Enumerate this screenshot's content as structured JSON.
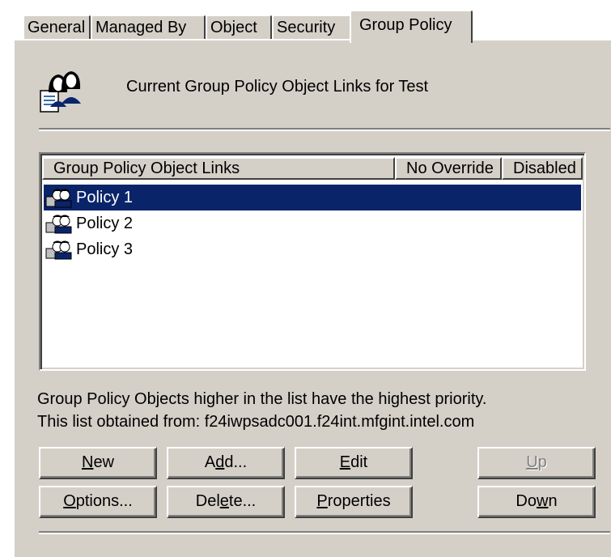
{
  "tabs": [
    {
      "label": "General"
    },
    {
      "label": "Managed By"
    },
    {
      "label": "Object"
    },
    {
      "label": "Security"
    },
    {
      "label": "Group Policy"
    }
  ],
  "active_tab": "Group Policy",
  "header": {
    "icon": "group-users-icon",
    "text": "Current Group Policy Object Links for Test"
  },
  "list": {
    "columns": [
      {
        "label": "Group Policy Object Links"
      },
      {
        "label": "No Override"
      },
      {
        "label": "Disabled"
      }
    ],
    "rows": [
      {
        "name": "Policy 1",
        "icon": "gpo-icon",
        "selected": true
      },
      {
        "name": "Policy 2",
        "icon": "gpo-icon",
        "selected": false
      },
      {
        "name": "Policy 3",
        "icon": "gpo-icon",
        "selected": false
      }
    ]
  },
  "info": {
    "line1": "Group Policy Objects higher in the list have the highest priority.",
    "line2": "This list obtained from: f24iwpsadc001.f24int.mfgint.intel.com"
  },
  "buttons": {
    "new": {
      "pre": "",
      "key": "N",
      "post": "ew",
      "enabled": true
    },
    "add": {
      "pre": "A",
      "key": "d",
      "post": "d...",
      "enabled": true
    },
    "edit": {
      "pre": "",
      "key": "E",
      "post": "dit",
      "enabled": true
    },
    "up": {
      "pre": "",
      "key": "U",
      "post": "p",
      "enabled": false
    },
    "options": {
      "pre": "",
      "key": "O",
      "post": "ptions...",
      "enabled": true
    },
    "delete": {
      "pre": "Del",
      "key": "e",
      "post": "te...",
      "enabled": true
    },
    "properties": {
      "pre": "",
      "key": "P",
      "post": "roperties",
      "enabled": true
    },
    "down": {
      "pre": "Do",
      "key": "w",
      "post": "n",
      "enabled": true
    }
  },
  "colors": {
    "selection": "#0a246a",
    "face": "#d4d0c8"
  }
}
